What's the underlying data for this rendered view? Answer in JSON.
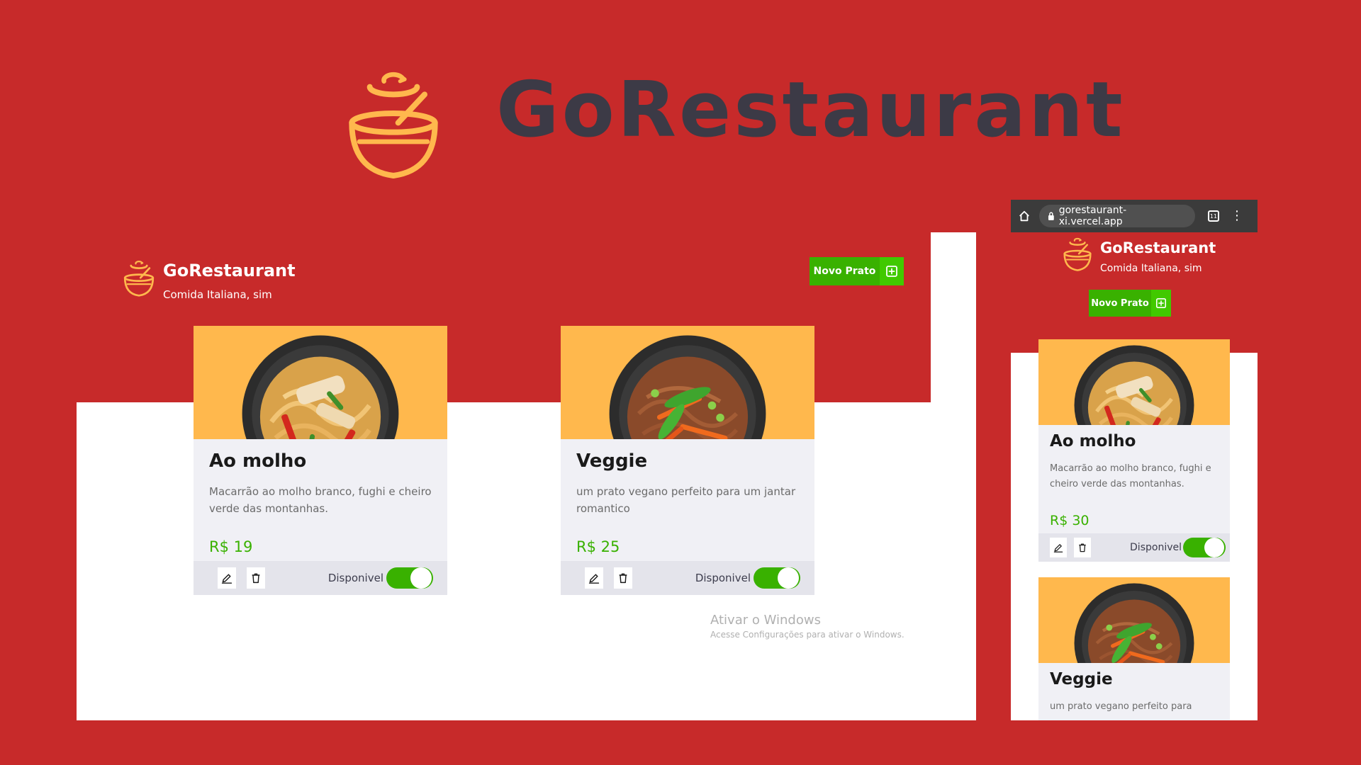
{
  "hero": {
    "title": "GoRestaurant"
  },
  "desktop": {
    "brand": {
      "name": "GoRestaurant",
      "subtitle": "Comida Italiana, sim"
    },
    "new_button_label": "Novo Prato",
    "foods": [
      {
        "name": "Ao molho",
        "description": "Macarrão ao molho branco, fughi e cheiro verde das montanhas.",
        "price": "R$ 19",
        "available_label": "Disponivel",
        "available": true
      },
      {
        "name": "Veggie",
        "description": "um prato vegano perfeito para um jantar romantico",
        "price": "R$ 25",
        "available_label": "Disponivel",
        "available": true
      }
    ]
  },
  "mobile": {
    "browser": {
      "url": "gorestaurant-xi.vercel.app",
      "tab_count": "11"
    },
    "brand": {
      "name": "GoRestaurant",
      "subtitle": "Comida Italiana, sim"
    },
    "new_button_label": "Novo Prato",
    "foods": [
      {
        "name": "Ao molho",
        "description": "Macarrão ao molho branco, fughi e cheiro verde das montanhas.",
        "price": "R$ 30",
        "available_label": "Disponivel",
        "available": true
      },
      {
        "name": "Veggie",
        "description": "um prato vegano perfeito para"
      }
    ]
  },
  "watermark": {
    "title": "Ativar o Windows",
    "subtitle": "Acesse Configurações para ativar o Windows."
  },
  "colors": {
    "background": "#c72a2a",
    "accent_green": "#39b100",
    "card_image_bg": "#ffb84d",
    "logo_orange": "#ffb84d",
    "title_dark": "#3c3a46"
  }
}
